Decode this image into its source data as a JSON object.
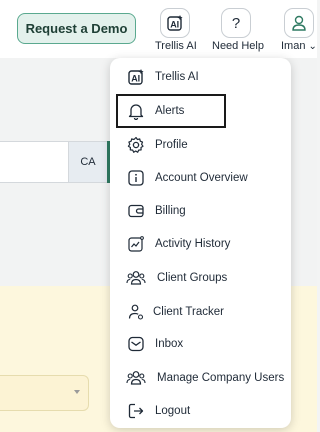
{
  "header": {
    "demo_label": "Request a Demo",
    "trellis_label": "Trellis AI",
    "help_label": "Need Help",
    "help_glyph": "?",
    "user_label": "Iman",
    "user_chevron": "⌄"
  },
  "background": {
    "ca_label": "CA"
  },
  "menu": {
    "items": [
      {
        "label": "Trellis AI",
        "icon": "ai-sparkle-icon"
      },
      {
        "label": "Alerts",
        "icon": "bell-icon"
      },
      {
        "label": "Profile",
        "icon": "gear-icon"
      },
      {
        "label": "Account Overview",
        "icon": "info-icon"
      },
      {
        "label": "Billing",
        "icon": "wallet-icon"
      },
      {
        "label": "Activity History",
        "icon": "activity-chart-icon"
      },
      {
        "label": "Client Groups",
        "icon": "users-group-icon"
      },
      {
        "label": "Client Tracker",
        "icon": "user-track-icon"
      },
      {
        "label": "Inbox",
        "icon": "inbox-icon"
      },
      {
        "label": "Manage Company Users",
        "icon": "users-group-icon"
      },
      {
        "label": "Logout",
        "icon": "logout-icon"
      }
    ]
  },
  "colors": {
    "accent": "#2f7a62",
    "demo_bg": "#e3f1ec",
    "highlight_border": "#1a1a1a"
  }
}
